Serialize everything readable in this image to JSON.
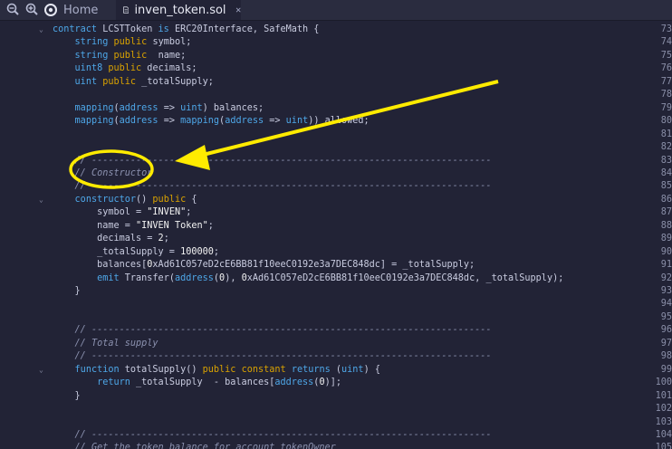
{
  "tabs": {
    "home_label": "Home",
    "file_label": "inven_token.sol",
    "zoom_out_icon": "zoom-out-icon",
    "zoom_in_icon": "zoom-in-icon"
  },
  "colors": {
    "keyword": "#4ea7e8",
    "modifier": "#d9a200",
    "comment": "#8c92b0",
    "annotation": "#ffeb00"
  },
  "lines": [
    {
      "n": "73",
      "t": "contract LCSTToken is ERC20Interface, SafeMath {"
    },
    {
      "n": "74",
      "t": "    string public symbol;"
    },
    {
      "n": "75",
      "t": "    string public  name;"
    },
    {
      "n": "76",
      "t": "    uint8 public decimals;"
    },
    {
      "n": "77",
      "t": "    uint public _totalSupply;"
    },
    {
      "n": "78",
      "t": ""
    },
    {
      "n": "79",
      "t": "    mapping(address => uint) balances;"
    },
    {
      "n": "80",
      "t": "    mapping(address => mapping(address => uint)) allowed;"
    },
    {
      "n": "81",
      "t": ""
    },
    {
      "n": "82",
      "t": ""
    },
    {
      "n": "83",
      "t": "    // ------------------------------------------------------------------------"
    },
    {
      "n": "84",
      "t": "    // Constructor"
    },
    {
      "n": "85",
      "t": "    // ------------------------------------------------------------------------"
    },
    {
      "n": "86",
      "t": "    constructor() public {"
    },
    {
      "n": "87",
      "t": "        symbol = \"INVEN\";"
    },
    {
      "n": "88",
      "t": "        name = \"INVEN Token\";"
    },
    {
      "n": "89",
      "t": "        decimals = 2;"
    },
    {
      "n": "90",
      "t": "        _totalSupply = 100000;"
    },
    {
      "n": "91",
      "t": "        balances[0xAd61C057eD2cE6BB81f10eeC0192e3a7DEC848dc] = _totalSupply;"
    },
    {
      "n": "92",
      "t": "        emit Transfer(address(0), 0xAd61C057eD2cE6BB81f10eeC0192e3a7DEC848dc, _totalSupply);"
    },
    {
      "n": "93",
      "t": "    }"
    },
    {
      "n": "94",
      "t": ""
    },
    {
      "n": "95",
      "t": ""
    },
    {
      "n": "96",
      "t": "    // ------------------------------------------------------------------------"
    },
    {
      "n": "97",
      "t": "    // Total supply"
    },
    {
      "n": "98",
      "t": "    // ------------------------------------------------------------------------"
    },
    {
      "n": "99",
      "t": "    function totalSupply() public constant returns (uint) {"
    },
    {
      "n": "100",
      "t": "        return _totalSupply  - balances[address(0)];"
    },
    {
      "n": "101",
      "t": "    }"
    },
    {
      "n": "102",
      "t": ""
    },
    {
      "n": "103",
      "t": ""
    },
    {
      "n": "104",
      "t": "    // ------------------------------------------------------------------------"
    },
    {
      "n": "105",
      "t": "    // Get the token balance for account tokenOwner"
    }
  ]
}
